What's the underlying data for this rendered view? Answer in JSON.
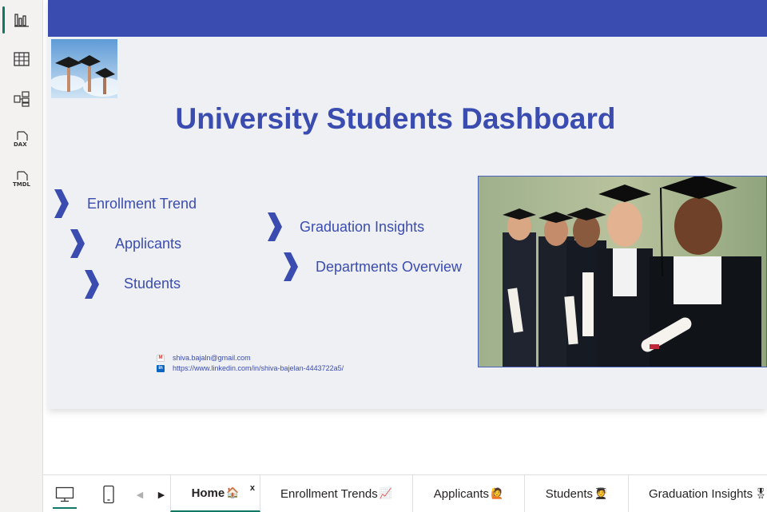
{
  "sidebar": {
    "items": [
      {
        "name": "report-view",
        "icon": "bar-chart-icon"
      },
      {
        "name": "table-view",
        "icon": "table-grid-icon"
      },
      {
        "name": "model-view",
        "icon": "model-icon"
      },
      {
        "name": "dax-query-view",
        "icon": "dax-doc-icon",
        "label": "DAX"
      },
      {
        "name": "tmdl-view",
        "icon": "tmdl-doc-icon",
        "label": "TMDL"
      }
    ]
  },
  "report": {
    "title": "University Students Dashboard",
    "accent": "#3b4cb0",
    "background": "#eef0f4",
    "nav": [
      {
        "label": "Enrollment Trend"
      },
      {
        "label": "Applicants"
      },
      {
        "label": "Students"
      },
      {
        "label": "Graduation Insights"
      },
      {
        "label": "Departments Overview"
      }
    ],
    "contact": {
      "email": "shiva.bajaln@gmail.com",
      "linkedin": "https://www.linkedin.com/in/shiva-bajelan-4443722a5/"
    }
  },
  "bottom_bar": {
    "close_label": "x",
    "tabs": [
      {
        "label": "Home",
        "emoji": "🏠"
      },
      {
        "label": "Enrollment Trends",
        "emoji": "📈"
      },
      {
        "label": "Applicants",
        "emoji": "🙋"
      },
      {
        "label": "Students",
        "emoji": "🧑‍🎓"
      },
      {
        "label": "Graduation Insights",
        "emoji": "🎖"
      }
    ]
  }
}
